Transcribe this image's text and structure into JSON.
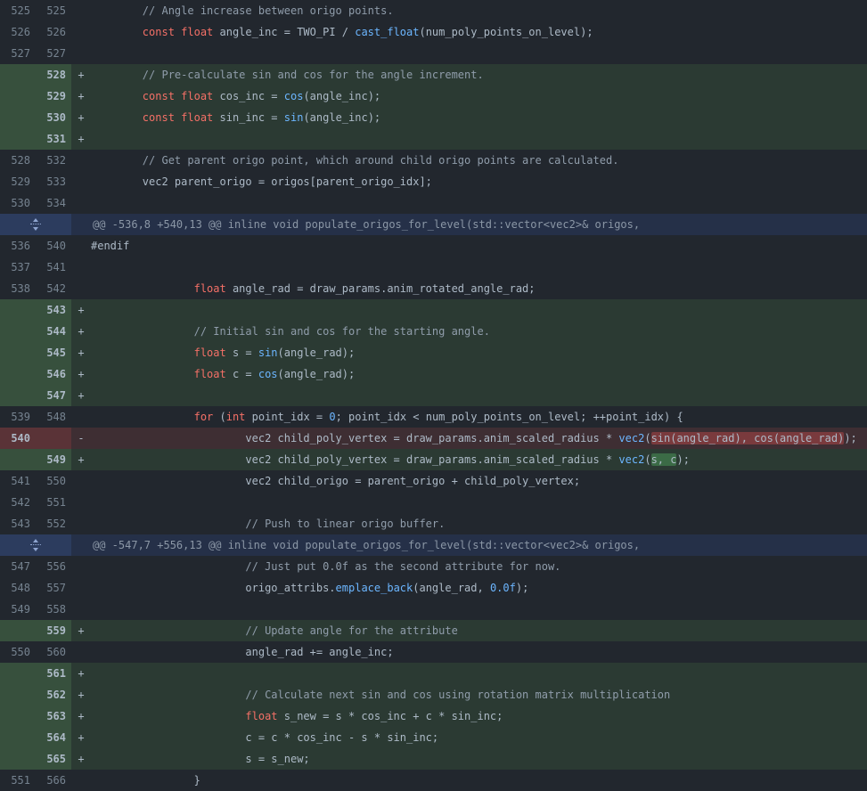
{
  "colors": {
    "background": "#22272e",
    "added_line": "#2b3a33",
    "deleted_line": "#3e2e33",
    "hunk_header": "#253048",
    "keyword": "#f47067",
    "function": "#6cb6ff",
    "comment": "#909dab"
  },
  "icons": {
    "expand": "unfold-icon"
  },
  "rows": [
    {
      "type": "ctx",
      "old": "525",
      "new": "525",
      "sign": "",
      "code": [
        {
          "t": "        "
        },
        {
          "t": "// Angle increase between origo points.",
          "c": "com"
        }
      ]
    },
    {
      "type": "ctx",
      "old": "526",
      "new": "526",
      "sign": "",
      "code": [
        {
          "t": "        "
        },
        {
          "t": "const float",
          "c": "kw"
        },
        {
          "t": " angle_inc = TWO_PI / "
        },
        {
          "t": "cast_float",
          "c": "fn"
        },
        {
          "t": "(num_poly_points_on_level);"
        }
      ]
    },
    {
      "type": "ctx",
      "old": "527",
      "new": "527",
      "sign": "",
      "code": [
        {
          "t": ""
        }
      ]
    },
    {
      "type": "add",
      "old": "",
      "new": "528",
      "sign": "+",
      "code": [
        {
          "t": "        "
        },
        {
          "t": "// Pre-calculate sin and cos for the angle increment.",
          "c": "com"
        }
      ]
    },
    {
      "type": "add",
      "old": "",
      "new": "529",
      "sign": "+",
      "code": [
        {
          "t": "        "
        },
        {
          "t": "const float",
          "c": "kw"
        },
        {
          "t": " cos_inc = "
        },
        {
          "t": "cos",
          "c": "fn"
        },
        {
          "t": "(angle_inc);"
        }
      ]
    },
    {
      "type": "add",
      "old": "",
      "new": "530",
      "sign": "+",
      "code": [
        {
          "t": "        "
        },
        {
          "t": "const float",
          "c": "kw"
        },
        {
          "t": " sin_inc = "
        },
        {
          "t": "sin",
          "c": "fn"
        },
        {
          "t": "(angle_inc);"
        }
      ]
    },
    {
      "type": "add",
      "old": "",
      "new": "531",
      "sign": "+",
      "code": [
        {
          "t": ""
        }
      ]
    },
    {
      "type": "ctx",
      "old": "528",
      "new": "532",
      "sign": "",
      "code": [
        {
          "t": "        "
        },
        {
          "t": "// Get parent origo point, which around child origo points are calculated.",
          "c": "com"
        }
      ]
    },
    {
      "type": "ctx",
      "old": "529",
      "new": "533",
      "sign": "",
      "code": [
        {
          "t": "        vec2 parent_origo = origos[parent_origo_idx];"
        }
      ]
    },
    {
      "type": "ctx",
      "old": "530",
      "new": "534",
      "sign": "",
      "code": [
        {
          "t": ""
        }
      ]
    },
    {
      "type": "hunk",
      "text": "@@ -536,8 +540,13 @@ inline void populate_origos_for_level(std::vector<vec2>& origos,"
    },
    {
      "type": "ctx",
      "old": "536",
      "new": "540",
      "sign": "",
      "code": [
        {
          "t": "#endif"
        }
      ]
    },
    {
      "type": "ctx",
      "old": "537",
      "new": "541",
      "sign": "",
      "code": [
        {
          "t": ""
        }
      ]
    },
    {
      "type": "ctx",
      "old": "538",
      "new": "542",
      "sign": "",
      "code": [
        {
          "t": "                "
        },
        {
          "t": "float",
          "c": "kw"
        },
        {
          "t": " angle_rad = draw_params.anim_rotated_angle_rad;"
        }
      ]
    },
    {
      "type": "add",
      "old": "",
      "new": "543",
      "sign": "+",
      "code": [
        {
          "t": ""
        }
      ]
    },
    {
      "type": "add",
      "old": "",
      "new": "544",
      "sign": "+",
      "code": [
        {
          "t": "                "
        },
        {
          "t": "// Initial sin and cos for the starting angle.",
          "c": "com"
        }
      ]
    },
    {
      "type": "add",
      "old": "",
      "new": "545",
      "sign": "+",
      "code": [
        {
          "t": "                "
        },
        {
          "t": "float",
          "c": "kw"
        },
        {
          "t": " s = "
        },
        {
          "t": "sin",
          "c": "fn"
        },
        {
          "t": "(angle_rad);"
        }
      ]
    },
    {
      "type": "add",
      "old": "",
      "new": "546",
      "sign": "+",
      "code": [
        {
          "t": "                "
        },
        {
          "t": "float",
          "c": "kw"
        },
        {
          "t": " c = "
        },
        {
          "t": "cos",
          "c": "fn"
        },
        {
          "t": "(angle_rad);"
        }
      ]
    },
    {
      "type": "add",
      "old": "",
      "new": "547",
      "sign": "+",
      "code": [
        {
          "t": ""
        }
      ]
    },
    {
      "type": "ctx",
      "old": "539",
      "new": "548",
      "sign": "",
      "code": [
        {
          "t": "                "
        },
        {
          "t": "for",
          "c": "kw"
        },
        {
          "t": " ("
        },
        {
          "t": "int",
          "c": "kw"
        },
        {
          "t": " point_idx = "
        },
        {
          "t": "0",
          "c": "num"
        },
        {
          "t": "; point_idx < num_poly_points_on_level; ++point_idx) {"
        }
      ]
    },
    {
      "type": "del",
      "old": "540",
      "new": "",
      "sign": "-",
      "code": [
        {
          "t": "                        vec2 child_poly_vertex = draw_params.anim_scaled_radius * "
        },
        {
          "t": "vec2",
          "c": "fn"
        },
        {
          "t": "("
        },
        {
          "t": "sin(angle_rad), cos(angle_rad)",
          "c": "hl-del"
        },
        {
          "t": ");"
        }
      ]
    },
    {
      "type": "add",
      "old": "",
      "new": "549",
      "sign": "+",
      "code": [
        {
          "t": "                        vec2 child_poly_vertex = draw_params.anim_scaled_radius * "
        },
        {
          "t": "vec2",
          "c": "fn"
        },
        {
          "t": "("
        },
        {
          "t": "s, c",
          "c": "hl-add"
        },
        {
          "t": ");"
        }
      ]
    },
    {
      "type": "ctx",
      "old": "541",
      "new": "550",
      "sign": "",
      "code": [
        {
          "t": "                        vec2 child_origo = parent_origo + child_poly_vertex;"
        }
      ]
    },
    {
      "type": "ctx",
      "old": "542",
      "new": "551",
      "sign": "",
      "code": [
        {
          "t": ""
        }
      ]
    },
    {
      "type": "ctx",
      "old": "543",
      "new": "552",
      "sign": "",
      "code": [
        {
          "t": "                        "
        },
        {
          "t": "// Push to linear origo buffer.",
          "c": "com"
        }
      ]
    },
    {
      "type": "hunk",
      "text": "@@ -547,7 +556,13 @@ inline void populate_origos_for_level(std::vector<vec2>& origos,"
    },
    {
      "type": "ctx",
      "old": "547",
      "new": "556",
      "sign": "",
      "code": [
        {
          "t": "                        "
        },
        {
          "t": "// Just put 0.0f as the second attribute for now.",
          "c": "com"
        }
      ]
    },
    {
      "type": "ctx",
      "old": "548",
      "new": "557",
      "sign": "",
      "code": [
        {
          "t": "                        origo_attribs."
        },
        {
          "t": "emplace_back",
          "c": "fn"
        },
        {
          "t": "(angle_rad, "
        },
        {
          "t": "0.0f",
          "c": "num"
        },
        {
          "t": ");"
        }
      ]
    },
    {
      "type": "ctx",
      "old": "549",
      "new": "558",
      "sign": "",
      "code": [
        {
          "t": ""
        }
      ]
    },
    {
      "type": "add",
      "old": "",
      "new": "559",
      "sign": "+",
      "code": [
        {
          "t": "                        "
        },
        {
          "t": "// Update angle for the attribute",
          "c": "com"
        }
      ]
    },
    {
      "type": "ctx",
      "old": "550",
      "new": "560",
      "sign": "",
      "code": [
        {
          "t": "                        angle_rad += angle_inc;"
        }
      ]
    },
    {
      "type": "add",
      "old": "",
      "new": "561",
      "sign": "+",
      "code": [
        {
          "t": ""
        }
      ]
    },
    {
      "type": "add",
      "old": "",
      "new": "562",
      "sign": "+",
      "code": [
        {
          "t": "                        "
        },
        {
          "t": "// Calculate next sin and cos using rotation matrix multiplication",
          "c": "com"
        }
      ]
    },
    {
      "type": "add",
      "old": "",
      "new": "563",
      "sign": "+",
      "code": [
        {
          "t": "                        "
        },
        {
          "t": "float",
          "c": "kw"
        },
        {
          "t": " s_new = s * cos_inc + c * sin_inc;"
        }
      ]
    },
    {
      "type": "add",
      "old": "",
      "new": "564",
      "sign": "+",
      "code": [
        {
          "t": "                        c = c * cos_inc - s * sin_inc;"
        }
      ]
    },
    {
      "type": "add",
      "old": "",
      "new": "565",
      "sign": "+",
      "code": [
        {
          "t": "                        s = s_new;"
        }
      ]
    },
    {
      "type": "ctx",
      "old": "551",
      "new": "566",
      "sign": "",
      "code": [
        {
          "t": "                }"
        }
      ]
    }
  ]
}
